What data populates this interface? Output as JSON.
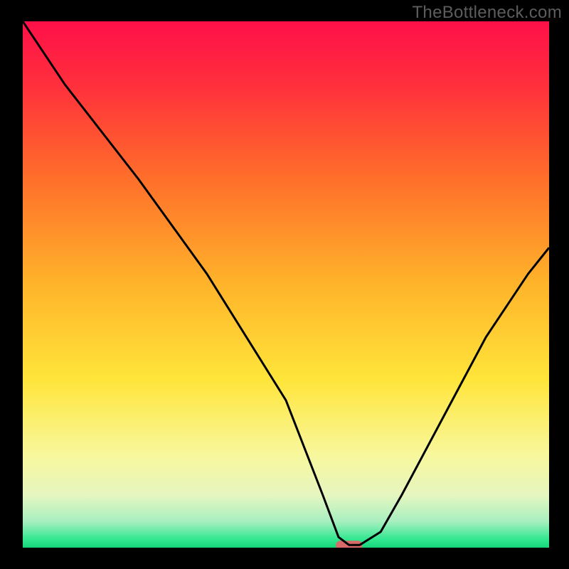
{
  "watermark": "TheBottleneck.com",
  "chart_data": {
    "type": "line",
    "title": "",
    "xlabel": "",
    "ylabel": "",
    "xlim": [
      0,
      100
    ],
    "ylim": [
      0,
      100
    ],
    "grid": false,
    "legend": false,
    "series": [
      {
        "name": "bottleneck-curve",
        "x": [
          0,
          8,
          22,
          35,
          50,
          57,
          60,
          62,
          64,
          68,
          72,
          80,
          88,
          96,
          100
        ],
        "values": [
          100,
          88,
          70,
          52,
          28,
          10,
          2,
          0.5,
          0.5,
          3,
          10,
          25,
          40,
          52,
          57
        ]
      }
    ],
    "marker": {
      "name": "optimal-range",
      "x_center": 62,
      "width": 5,
      "y": 0.5,
      "color": "#d96a6a"
    },
    "gradient_stops": [
      {
        "pos": 0.0,
        "color": "#ff1049"
      },
      {
        "pos": 0.12,
        "color": "#ff2f3c"
      },
      {
        "pos": 0.3,
        "color": "#ff6f2a"
      },
      {
        "pos": 0.5,
        "color": "#ffb42a"
      },
      {
        "pos": 0.68,
        "color": "#ffe53a"
      },
      {
        "pos": 0.82,
        "color": "#f8f79a"
      },
      {
        "pos": 0.9,
        "color": "#e6f6c0"
      },
      {
        "pos": 0.95,
        "color": "#a8efc0"
      },
      {
        "pos": 0.985,
        "color": "#2fe78f"
      },
      {
        "pos": 1.0,
        "color": "#17d47a"
      }
    ]
  }
}
